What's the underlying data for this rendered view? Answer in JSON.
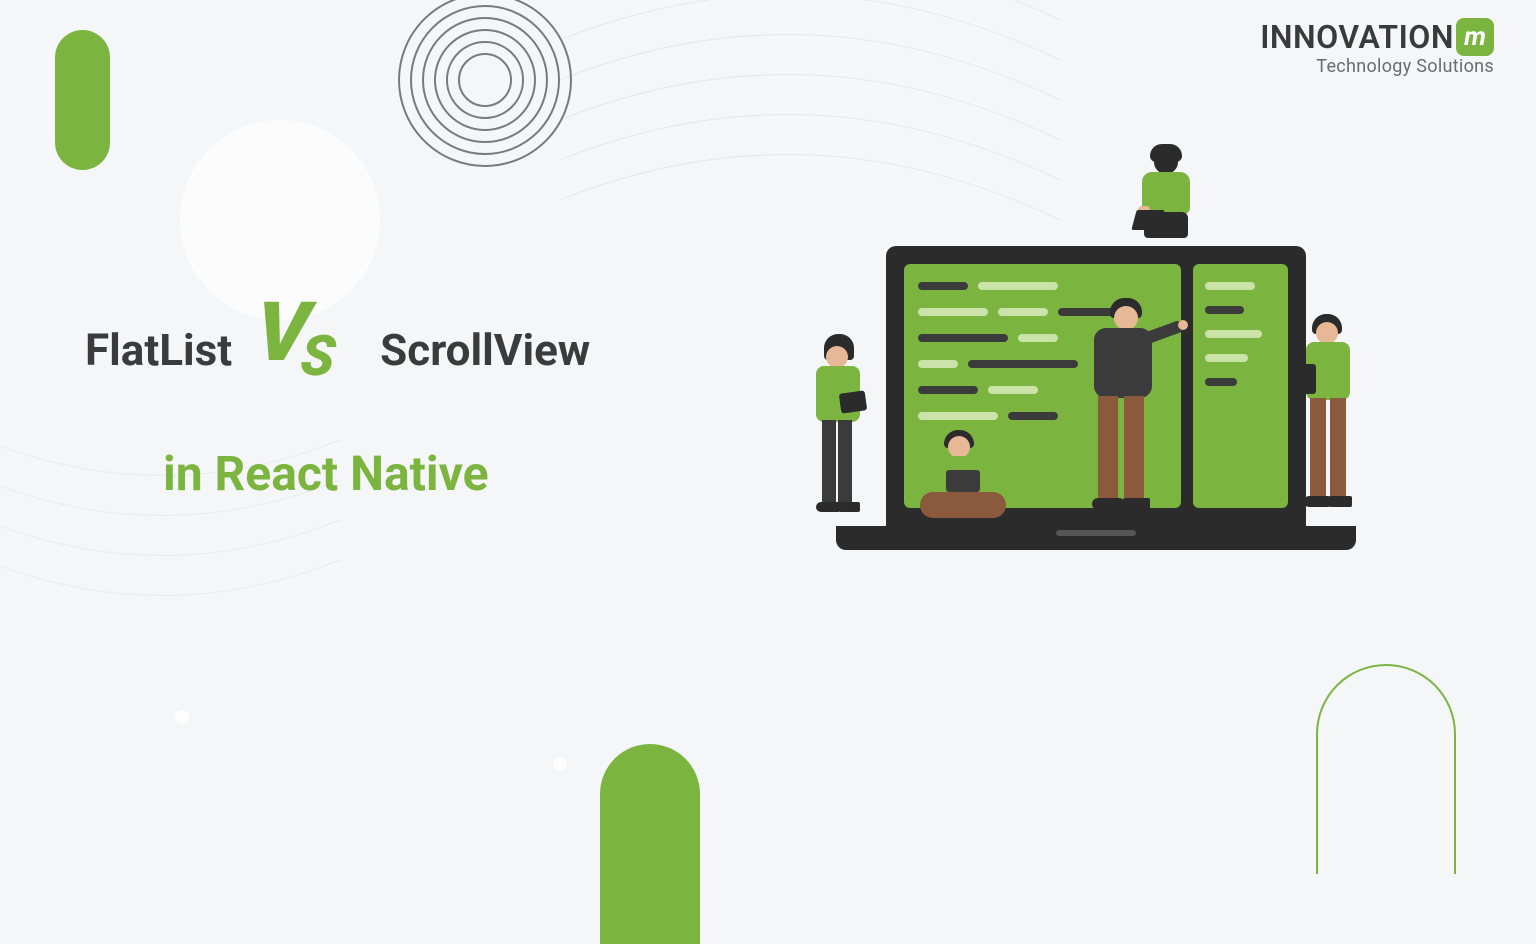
{
  "brand": {
    "name": "INNOVATION",
    "badge": "m",
    "tagline": "Technology Solutions"
  },
  "title": {
    "left": "FlatList",
    "vs_v": "V",
    "vs_s": "S",
    "right": "ScrollView",
    "subtitle": "in React Native"
  },
  "colors": {
    "accent": "#7bb540",
    "text": "#3b3b3b"
  }
}
